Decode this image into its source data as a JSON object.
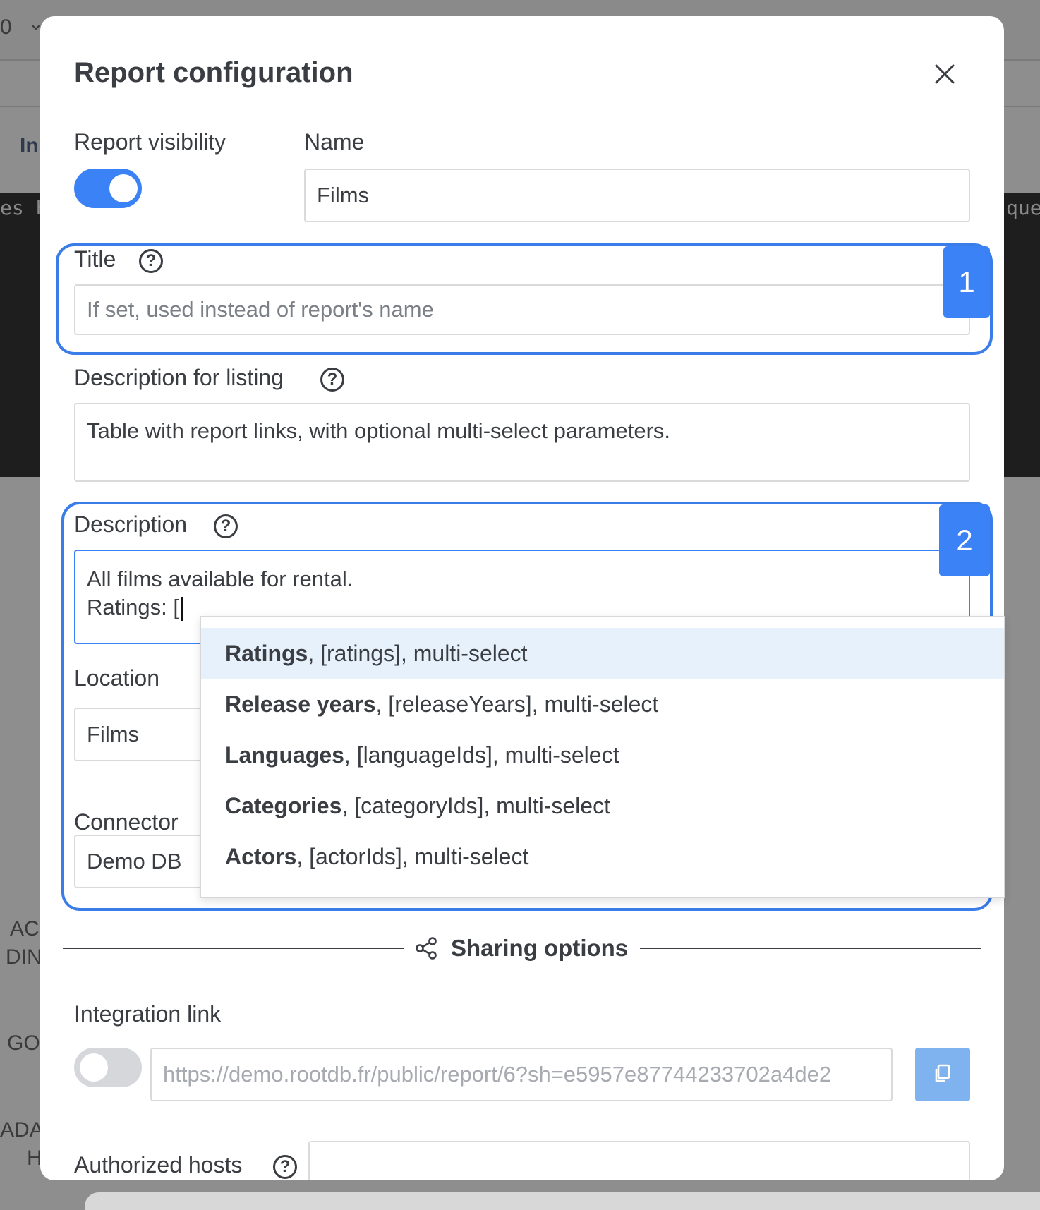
{
  "background": {
    "top_left_text": "0",
    "in_text": "In",
    "mono_left": "es h",
    "mono_right": "que",
    "row_ac": "AC",
    "row_din": "DIN",
    "row_go": "GO",
    "row_ada": "ADA",
    "row_h": "H"
  },
  "modal": {
    "title": "Report configuration",
    "close_icon": "close-icon",
    "visibility": {
      "label": "Report visibility",
      "enabled": true
    },
    "name": {
      "label": "Name",
      "value": "Films"
    },
    "title_field": {
      "label": "Title",
      "placeholder": "If set, used instead of report's name",
      "badge": "1"
    },
    "description_listing": {
      "label": "Description for listing",
      "value": "Table with report links, with optional multi-select parameters."
    },
    "description": {
      "label": "Description",
      "line1": "All films available for rental.",
      "line2": "Ratings: [",
      "badge": "2"
    },
    "location": {
      "label": "Location",
      "value": "Films"
    },
    "connector": {
      "label": "Connector",
      "value": "Demo DB"
    },
    "autocomplete": [
      {
        "name": "Ratings",
        "rest": ", [ratings], multi-select",
        "active": true
      },
      {
        "name": "Release years",
        "rest": ", [releaseYears], multi-select",
        "active": false
      },
      {
        "name": "Languages",
        "rest": ", [languageIds], multi-select",
        "active": false
      },
      {
        "name": "Categories",
        "rest": ", [categoryIds], multi-select",
        "active": false
      },
      {
        "name": "Actors",
        "rest": ", [actorIds], multi-select",
        "active": false
      }
    ],
    "sharing": {
      "heading": "Sharing options",
      "icon": "share-icon",
      "integration_label": "Integration link",
      "integration_enabled": false,
      "link_placeholder": "https://demo.rootdb.fr/public/report/6?sh=e5957e87744233702a4de2",
      "copy_icon": "copy-icon",
      "authorized_hosts_label": "Authorized hosts",
      "authorized_hosts_value": ""
    }
  },
  "colors": {
    "accent": "#3b82f6",
    "highlight_border": "#3a7ce8",
    "dropdown_active": "#e6f1fb",
    "toggle_off": "#d5d7db"
  }
}
